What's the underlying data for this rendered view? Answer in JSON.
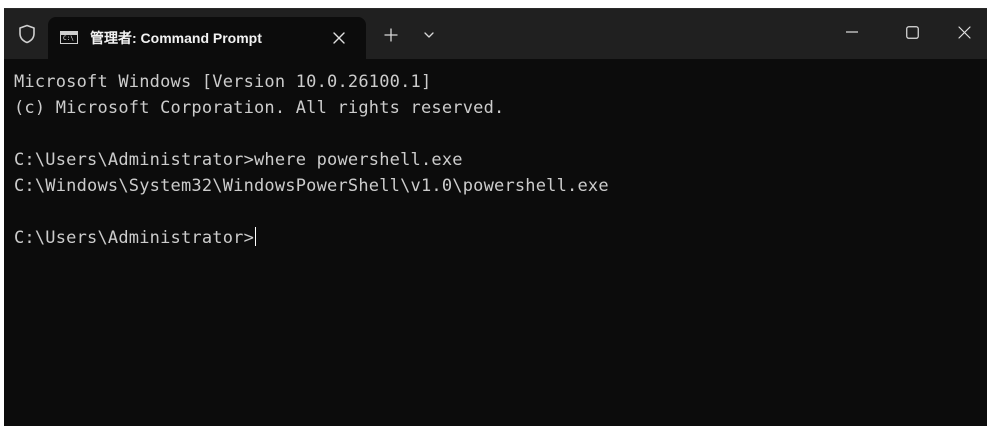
{
  "window": {
    "tab_title": "管理者: Command Prompt",
    "tab_icon_text": "C:\\",
    "icons": {
      "shield": "shield-icon",
      "tab": "console-icon",
      "tab_close": "close-icon",
      "new_tab": "plus-icon",
      "dropdown": "chevron-down-icon",
      "minimize": "minimize-icon",
      "maximize": "maximize-icon",
      "close": "close-icon"
    }
  },
  "terminal": {
    "lines": [
      "Microsoft Windows [Version 10.0.26100.1]",
      "(c) Microsoft Corporation. All rights reserved.",
      "",
      "C:\\Users\\Administrator>where powershell.exe",
      "C:\\Windows\\System32\\WindowsPowerShell\\v1.0\\powershell.exe",
      "",
      "C:\\Users\\Administrator>"
    ]
  },
  "colors": {
    "titlebar": "#202020",
    "background": "#0c0c0c",
    "text": "#cccccc"
  }
}
